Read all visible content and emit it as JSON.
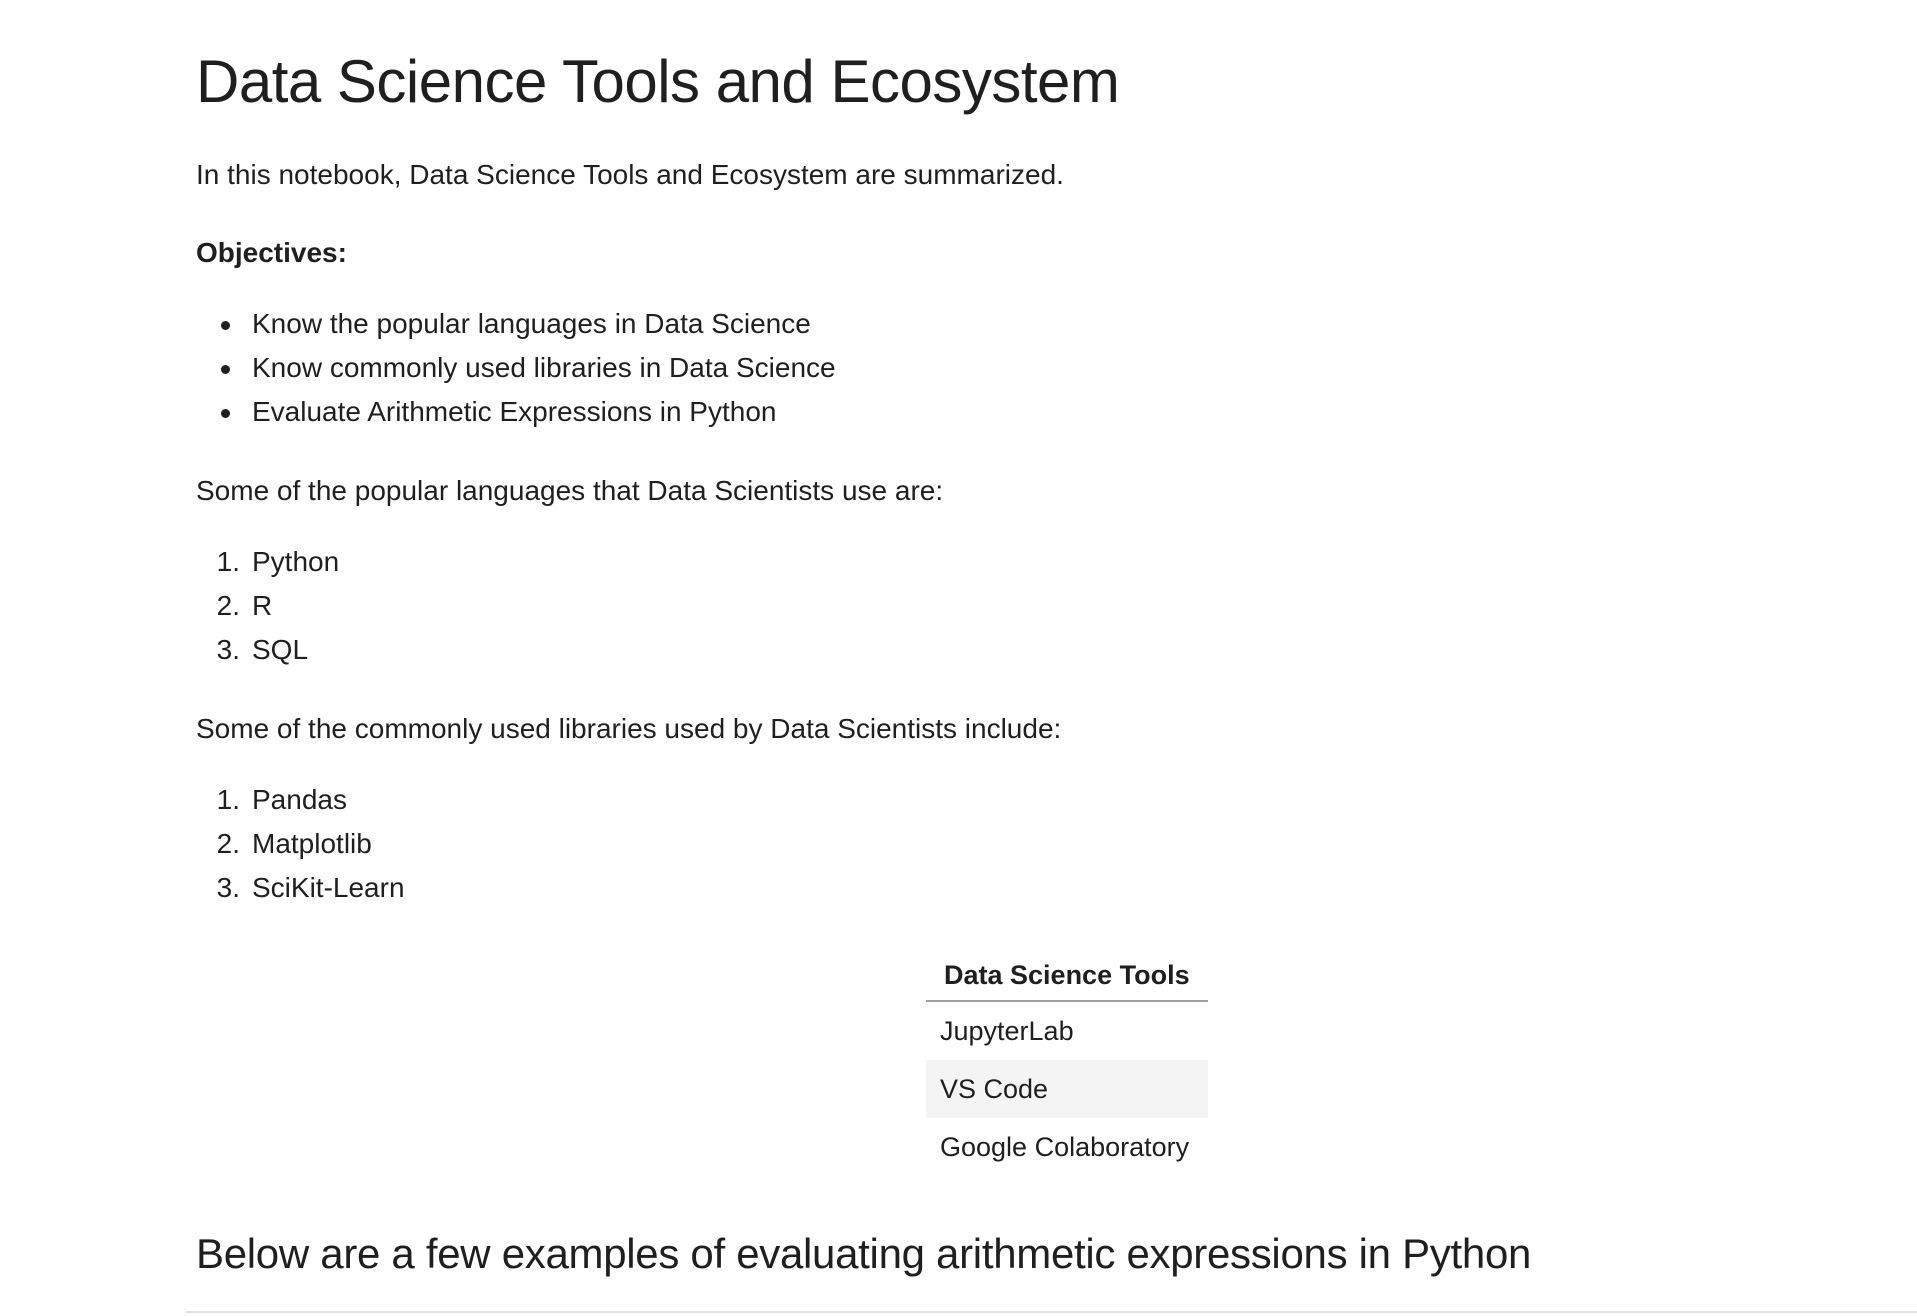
{
  "title": "Data Science Tools and Ecosystem",
  "intro": "In this notebook, Data Science Tools and Ecosystem are summarized.",
  "objectives": {
    "heading": "Objectives:",
    "items": [
      "Know the popular languages in Data Science",
      "Know commonly used libraries in Data Science",
      "Evaluate Arithmetic Expressions in Python"
    ]
  },
  "languages": {
    "intro": "Some of the popular languages that Data Scientists use are:",
    "items": [
      "Python",
      "R",
      "SQL"
    ]
  },
  "libraries": {
    "intro": "Some of the commonly used libraries used by Data Scientists include:",
    "items": [
      "Pandas",
      "Matplotlib",
      "SciKit-Learn"
    ]
  },
  "tools_table": {
    "header": "Data Science Tools",
    "rows": [
      "JupyterLab",
      "VS Code",
      "Google Colaboratory"
    ]
  },
  "arithmetic_heading": "Below are a few examples of evaluating arithmetic expressions in Python"
}
